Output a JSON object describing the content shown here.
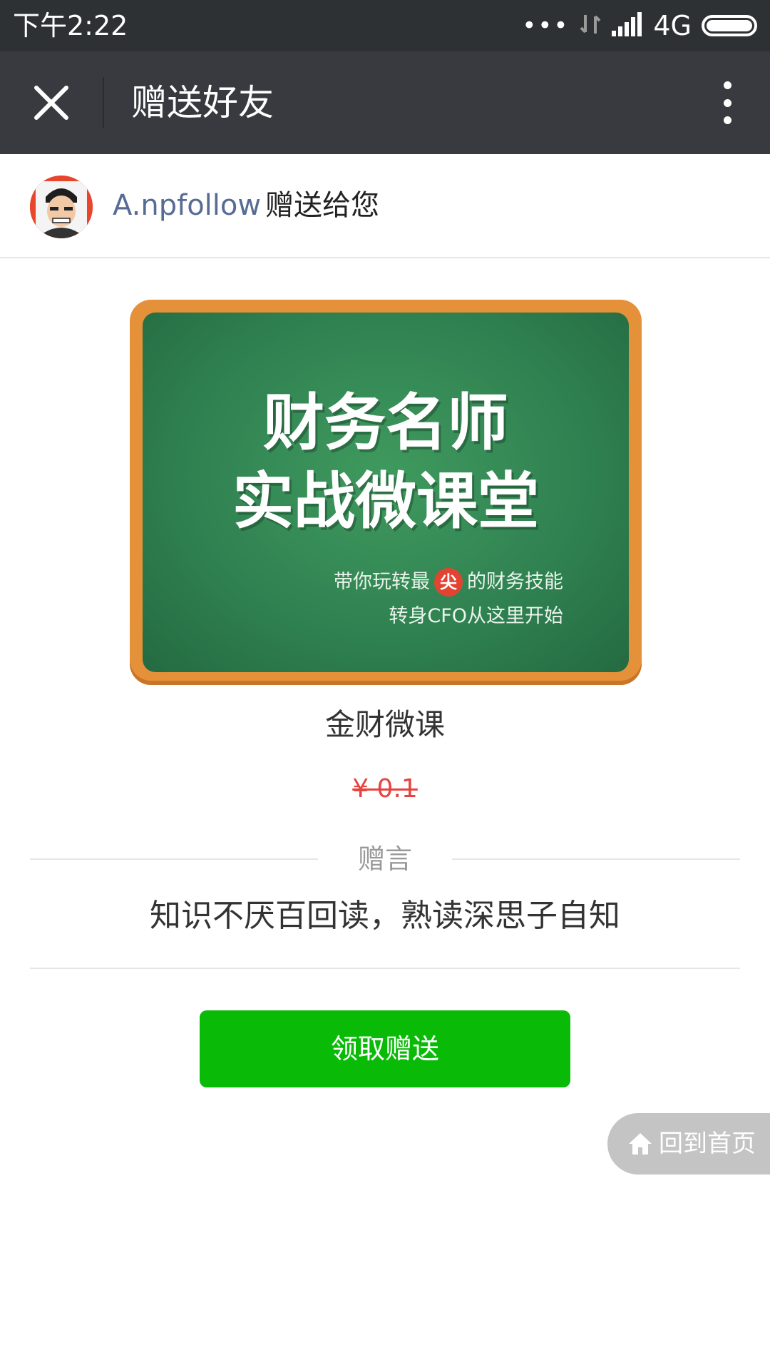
{
  "status_bar": {
    "time": "下午2:22",
    "dots": "•••",
    "network": "4G",
    "icons": [
      "signal-arrows-icon",
      "signal-bars-icon",
      "battery-icon"
    ]
  },
  "title_bar": {
    "title": "赠送好友",
    "icons": [
      "close-icon",
      "more-vertical-icon"
    ]
  },
  "sender": {
    "name": "A.npfollow",
    "action": "赠送给您"
  },
  "cover": {
    "line1": "财务名师",
    "line2": "实战微课堂",
    "tag1_before": "带你玩转最",
    "tag1_badge": "尖",
    "tag1_after": "的财务技能",
    "tag2": "转身CFO从这里开始"
  },
  "product": {
    "name": "金财微课",
    "price": "¥ 0.1"
  },
  "message": {
    "label": "赠言",
    "text": "知识不厌百回读，熟读深思子自知"
  },
  "actions": {
    "claim": "领取赠送",
    "home": "回到首页"
  },
  "colors": {
    "status_bar": "#2e3133",
    "title_bar": "#393a3f",
    "sender_name": "#576b95",
    "price": "#e64340",
    "button": "#09bb07",
    "home_pill": "#c4c4c4",
    "board_frame": "#e5913a",
    "board": "#2f8050"
  }
}
